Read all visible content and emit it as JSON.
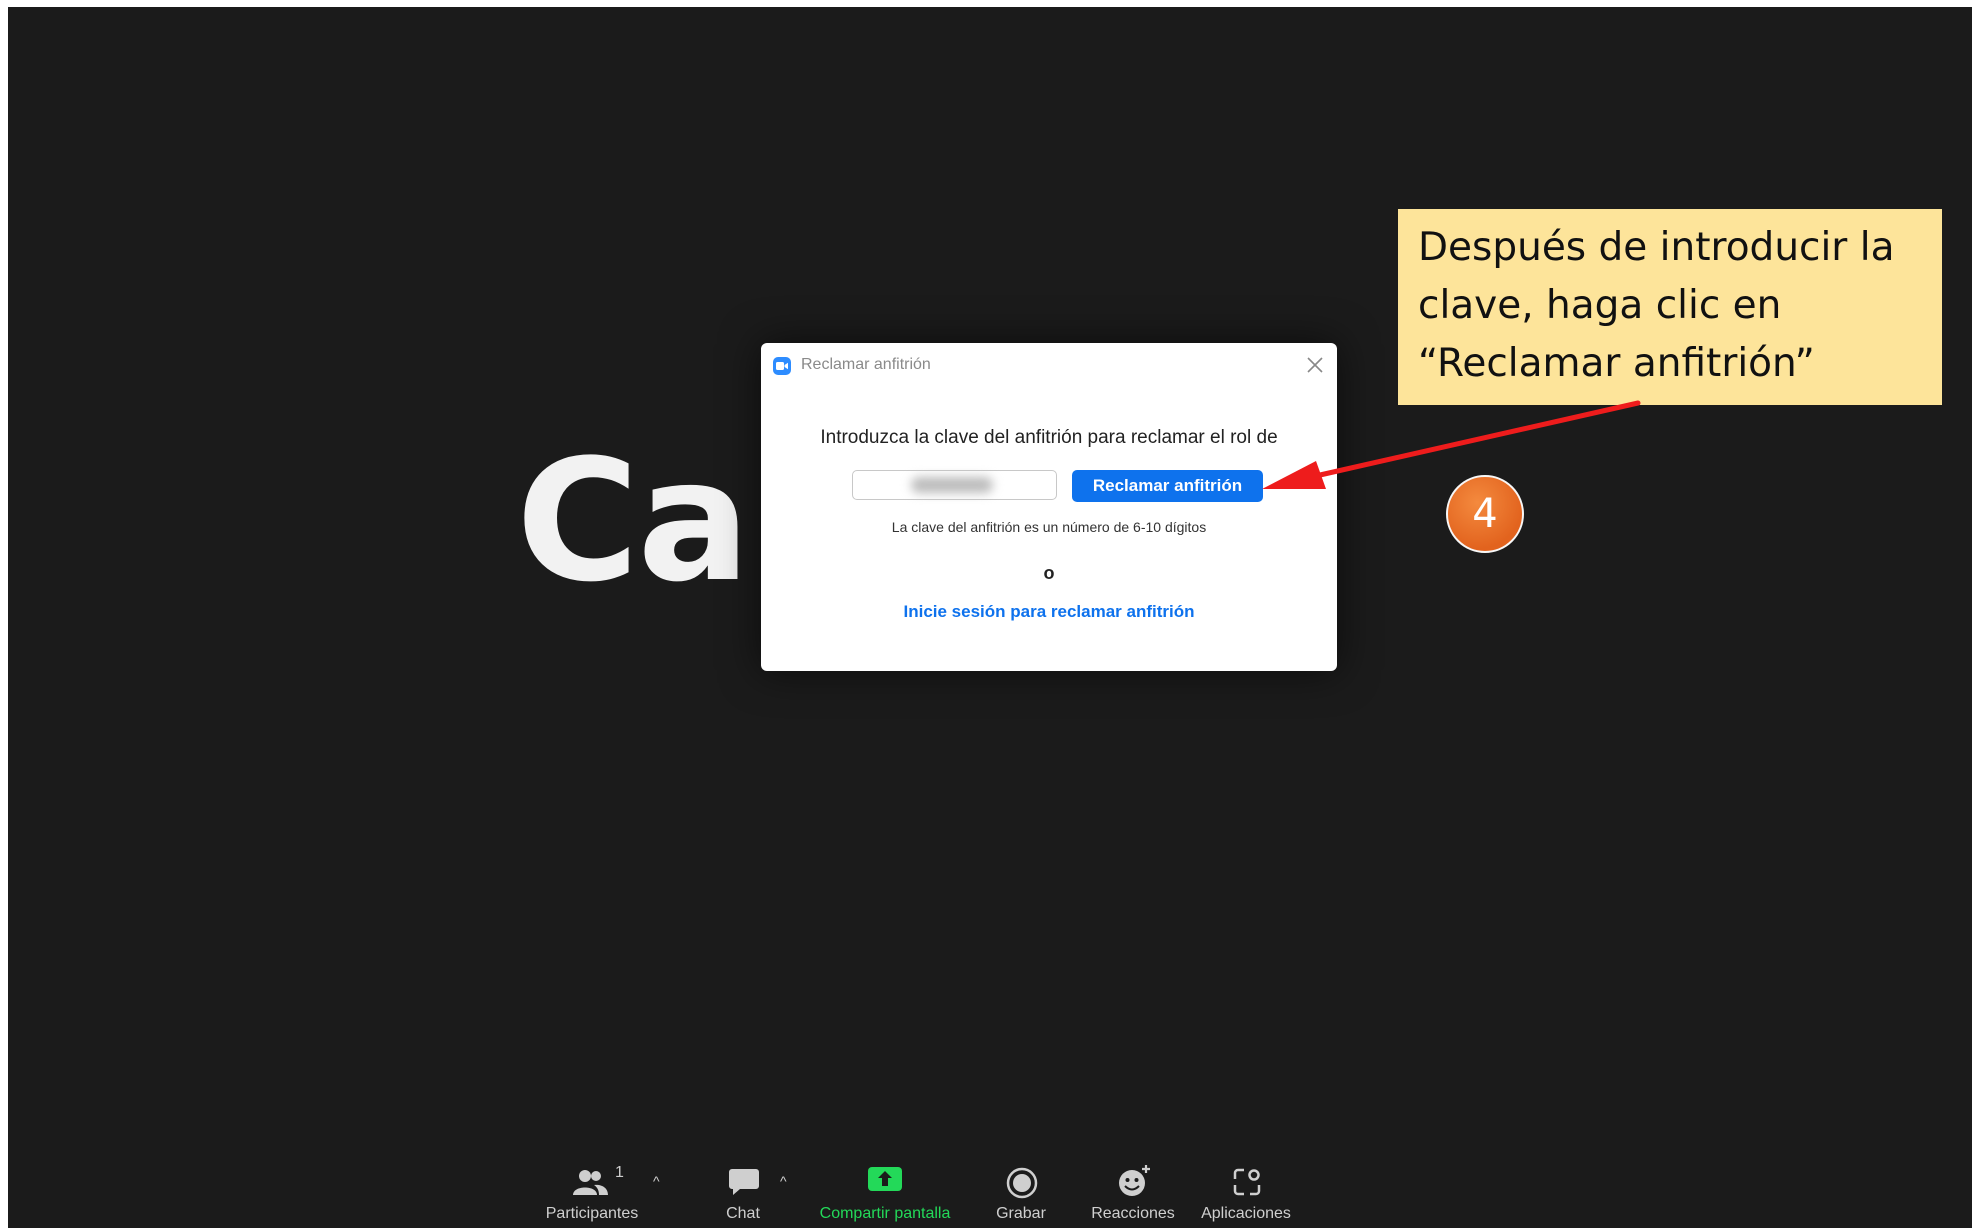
{
  "background": {
    "name_partial": "Car"
  },
  "dialog": {
    "title": "Reclamar anfitrión",
    "prompt": "Introduzca la clave del anfitrión para reclamar el rol de",
    "key_input_value": "",
    "claim_button_label": "Reclamar anfitrión",
    "hint": "La clave del anfitrión es un número de 6-10 dígitos",
    "or_label": "o",
    "signin_link": "Inicie sesión para reclamar anfitrión"
  },
  "callout": {
    "text": "Después de introducir la clave, haga clic en “Reclamar anfitrión”",
    "step_number": "4",
    "bg_color": "#fde49a",
    "arrow_color": "#ee1c1c",
    "badge_color": "#e8692a"
  },
  "toolbar": {
    "participants_label": "Participantes",
    "participants_count": "1",
    "chat_label": "Chat",
    "share_label": "Compartir pantalla",
    "record_label": "Grabar",
    "reactions_label": "Reacciones",
    "apps_label": "Aplicaciones",
    "share_color": "#23d959",
    "icons": {
      "participants": "participants-icon",
      "chat": "chat-icon",
      "share": "share-screen-icon",
      "record": "record-icon",
      "reactions": "reactions-icon",
      "apps": "apps-icon"
    }
  }
}
